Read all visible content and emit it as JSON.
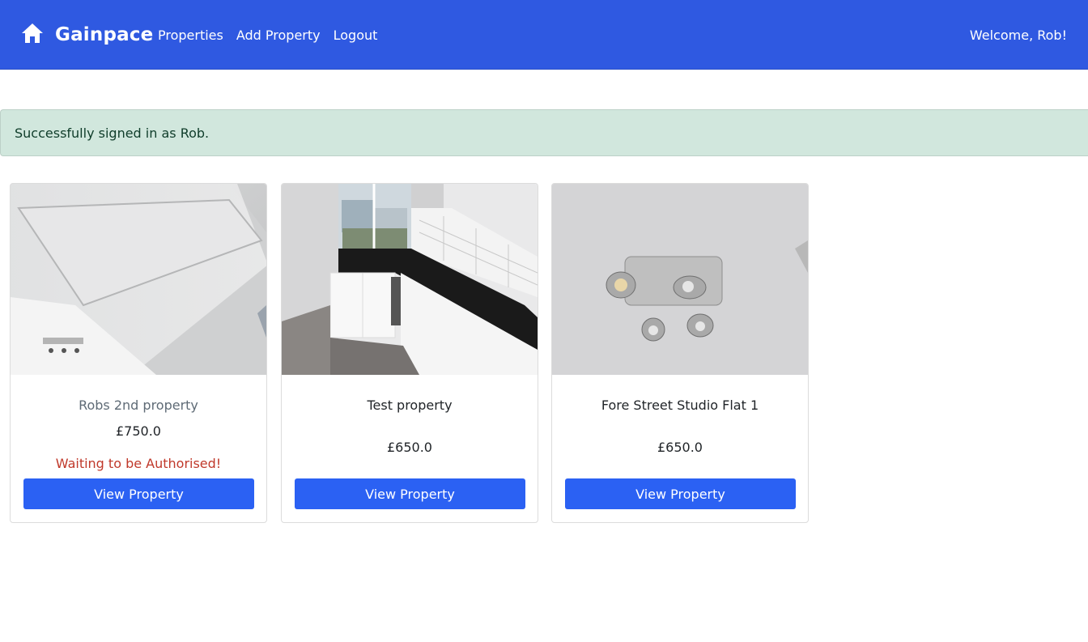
{
  "nav": {
    "brand": "Gainpace",
    "links": [
      "Properties",
      "Add Property",
      "Logout"
    ],
    "welcome": "Welcome, Rob!"
  },
  "alert": {
    "message": "Successfully signed in as Rob."
  },
  "properties": [
    {
      "title": "Robs 2nd property",
      "price": "£750.0",
      "status": "Waiting to be Authorised!",
      "button": "View Property"
    },
    {
      "title": "Test property",
      "price": "£650.0",
      "status": "",
      "button": "View Property"
    },
    {
      "title": "Fore Street Studio Flat 1",
      "price": "£650.0",
      "status": "",
      "button": "View Property"
    }
  ]
}
